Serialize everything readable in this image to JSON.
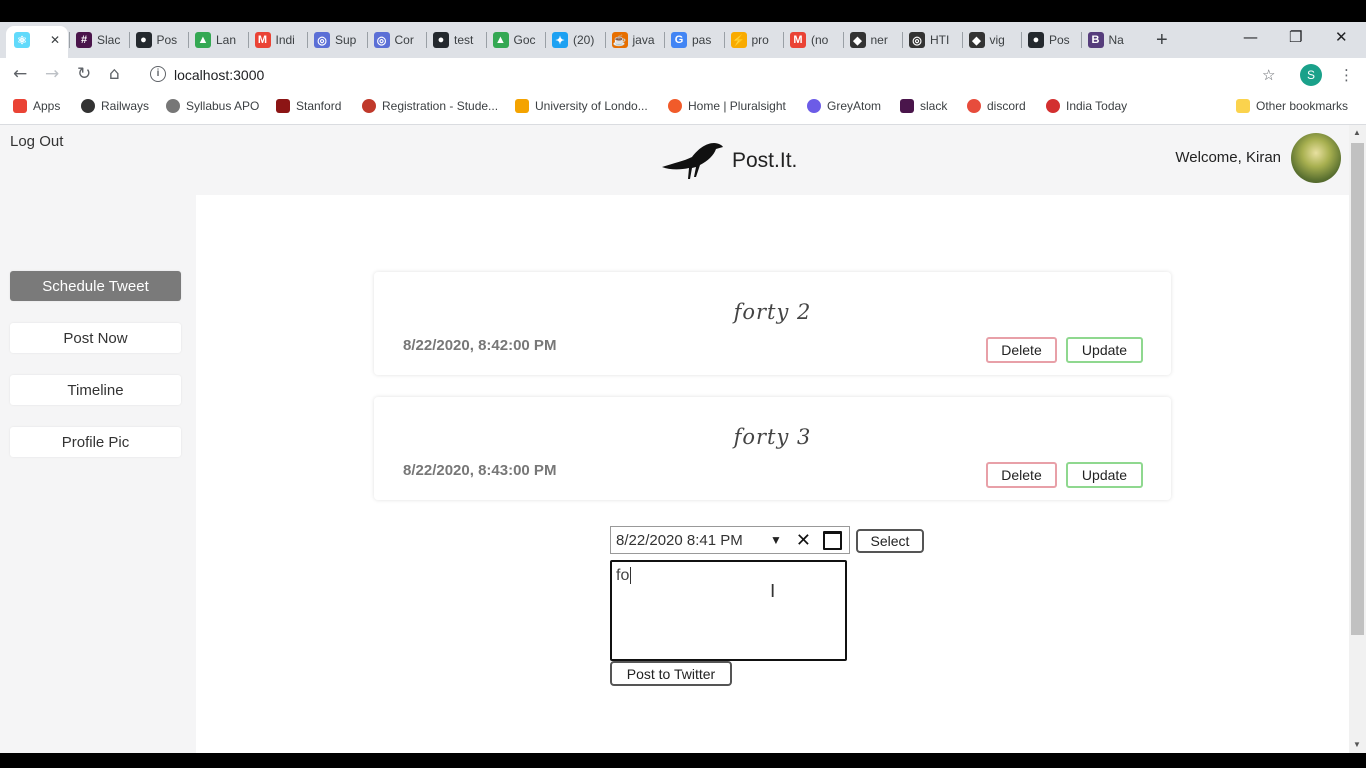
{
  "browser": {
    "tabs": [
      {
        "label": "",
        "icon": "react-icon",
        "color": "#61dafb"
      },
      {
        "label": "Slac",
        "icon": "slack-icon",
        "color": "#4a154b"
      },
      {
        "label": "Pos",
        "icon": "github-icon",
        "color": "#24292e"
      },
      {
        "label": "Lan",
        "icon": "drive-icon",
        "color": "#34a853"
      },
      {
        "label": "Indi",
        "icon": "gmail-icon",
        "color": "#ea4335"
      },
      {
        "label": "Sup",
        "icon": "globe-icon",
        "color": "#5b6fd6"
      },
      {
        "label": "Cor",
        "icon": "globe-icon",
        "color": "#5b6fd6"
      },
      {
        "label": "test",
        "icon": "github-icon",
        "color": "#24292e"
      },
      {
        "label": "Goc",
        "icon": "drive-icon",
        "color": "#34a853"
      },
      {
        "label": "(20)",
        "icon": "twitter-icon",
        "color": "#1da1f2"
      },
      {
        "label": "java",
        "icon": "java-icon",
        "color": "#e76f00"
      },
      {
        "label": "pas",
        "icon": "google-icon",
        "color": "#4285f4"
      },
      {
        "label": "pro",
        "icon": "bolt-icon",
        "color": "#f9ab00"
      },
      {
        "label": "(no",
        "icon": "gmail-icon",
        "color": "#ea4335"
      },
      {
        "label": "ner",
        "icon": "cube-icon",
        "color": "#333333"
      },
      {
        "label": "HTI",
        "icon": "globe-icon",
        "color": "#333333"
      },
      {
        "label": "vig",
        "icon": "cube-icon",
        "color": "#333333"
      },
      {
        "label": "Pos",
        "icon": "github-icon",
        "color": "#24292e"
      },
      {
        "label": "Na",
        "icon": "bootstrap-icon",
        "color": "#563d7c"
      }
    ],
    "new_tab": "+",
    "close_tab": "✕",
    "url": "localhost:3000",
    "profile_initial": "S",
    "bookmarks": [
      {
        "label": "Apps",
        "color": "#ea4335"
      },
      {
        "label": "Railways",
        "color": "#333333"
      },
      {
        "label": "Syllabus APO",
        "color": "#777777"
      },
      {
        "label": "Stanford",
        "color": "#8c1515"
      },
      {
        "label": "Registration - Stude...",
        "color": "#c0392b"
      },
      {
        "label": "University of Londo...",
        "color": "#f4a300"
      },
      {
        "label": "Home | Pluralsight",
        "color": "#f15b2a"
      },
      {
        "label": "GreyAtom",
        "color": "#6c5ce7"
      },
      {
        "label": "slack",
        "color": "#4a154b"
      },
      {
        "label": "discord",
        "color": "#e74c3c"
      },
      {
        "label": "India Today",
        "color": "#d32f2f"
      }
    ],
    "other_bookmarks": "Other bookmarks"
  },
  "header": {
    "logout": "Log Out",
    "brand": "Post.It.",
    "welcome": "Welcome, Kiran"
  },
  "sidebar": {
    "items": [
      {
        "label": "Schedule Tweet"
      },
      {
        "label": "Post Now"
      },
      {
        "label": "Timeline"
      },
      {
        "label": "Profile Pic"
      }
    ]
  },
  "posts": [
    {
      "text": "forty 2",
      "date": "8/22/2020, 8:42:00 PM",
      "delete": "Delete",
      "update": "Update"
    },
    {
      "text": "forty 3",
      "date": "8/22/2020, 8:43:00 PM",
      "delete": "Delete",
      "update": "Update"
    }
  ],
  "composer": {
    "datetime_value": "8/22/2020  8:41  PM",
    "select_label": "Select",
    "tweet_value": "fo",
    "post_label": "Post to Twitter"
  }
}
